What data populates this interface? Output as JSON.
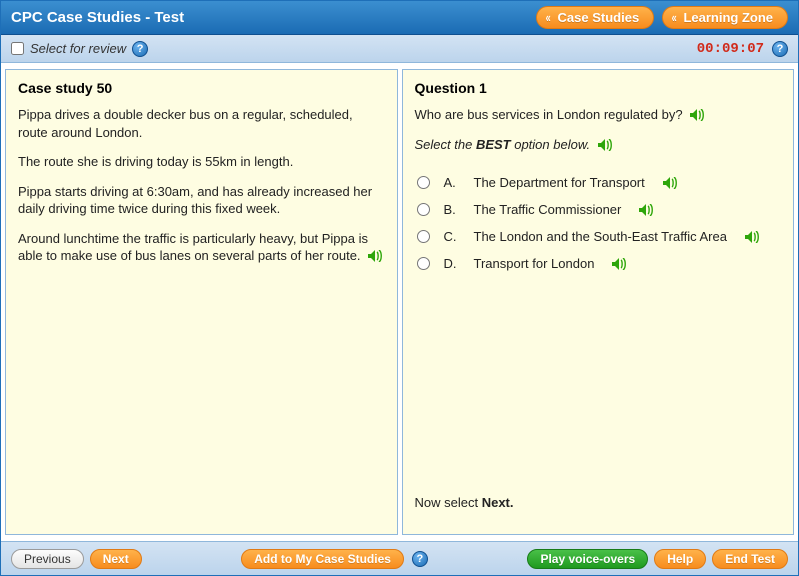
{
  "header": {
    "title": "CPC Case Studies - Test",
    "nav": {
      "case_studies": "Case Studies",
      "learning_zone": "Learning Zone"
    }
  },
  "subbar": {
    "select_for_review": "Select for review",
    "timer": "00:09:07"
  },
  "case": {
    "heading": "Case study 50",
    "p1": "Pippa drives a double decker bus on a regular, scheduled, route around London.",
    "p2": "The route she is driving today is 55km in length.",
    "p3": "Pippa starts driving at 6:30am, and has already increased her daily driving time twice during this fixed week.",
    "p4": "Around lunchtime the traffic is particularly heavy, but Pippa is able to make use of bus lanes on several parts of her route."
  },
  "question": {
    "heading": "Question 1",
    "prompt": "Who are bus services in London regulated by?",
    "instruction_prefix": "Select the ",
    "instruction_bold": "BEST",
    "instruction_suffix": " option below.",
    "options": [
      {
        "letter": "A.",
        "text": "The Department for Transport"
      },
      {
        "letter": "B.",
        "text": "The Traffic Commissioner"
      },
      {
        "letter": "C.",
        "text": "The London and the South-East Traffic Area"
      },
      {
        "letter": "D.",
        "text": "Transport for London"
      }
    ],
    "hint_prefix": "Now select ",
    "hint_bold": "Next."
  },
  "footer": {
    "previous": "Previous",
    "next": "Next",
    "add_to_my": "Add to My Case Studies",
    "play_voice": "Play voice-overs",
    "help": "Help",
    "end_test": "End Test"
  }
}
